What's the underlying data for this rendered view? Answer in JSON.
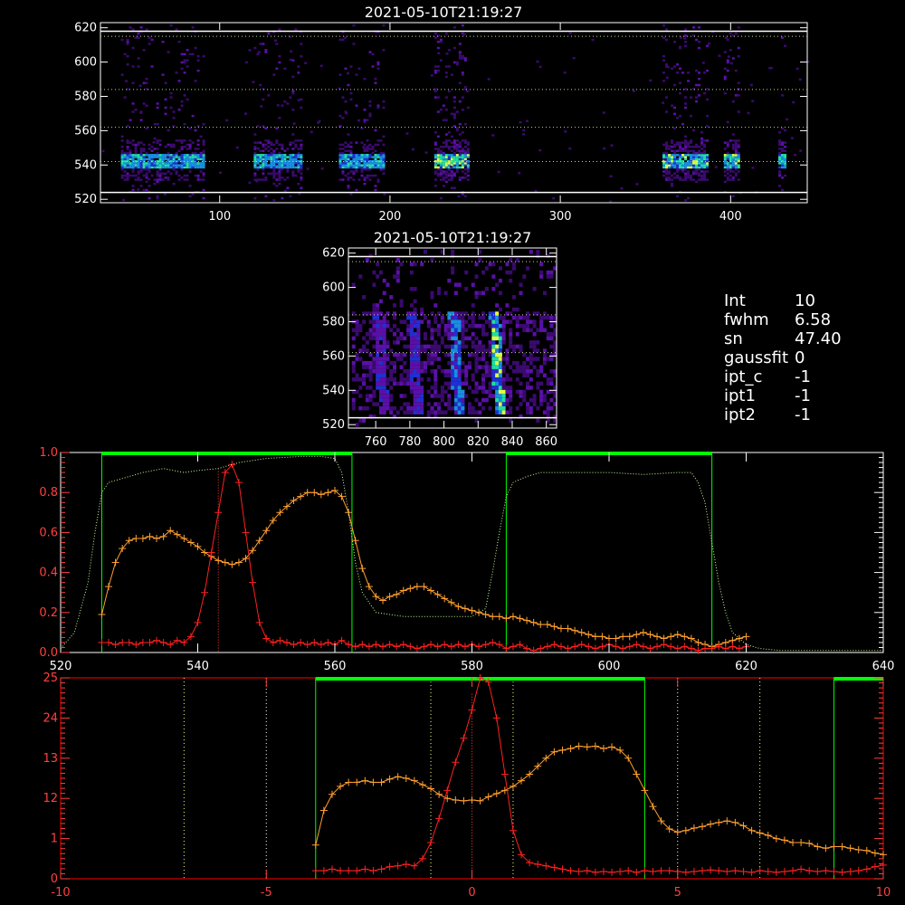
{
  "colors": {
    "background": "#000000",
    "axis": "#ffffff",
    "red_axis": "#ff0000",
    "spectrum_red": "#ff2020",
    "spectrum_orange": "#ffa030",
    "filter_green": "#00ff00",
    "filter_dotted": "#ccff99",
    "ref_lines": "#ffff80"
  },
  "panels": {
    "top": {
      "title": "2021-05-10T21:19:27",
      "x_ticks": [
        "100",
        "200",
        "300",
        "400"
      ],
      "y_ticks": [
        "520",
        "540",
        "560",
        "580",
        "600",
        "620"
      ]
    },
    "middle": {
      "title": "2021-05-10T21:19:27",
      "x_ticks": [
        "760",
        "780",
        "800",
        "820",
        "840",
        "860"
      ],
      "y_ticks": [
        "520",
        "540",
        "560",
        "580",
        "600",
        "620"
      ]
    }
  },
  "info": [
    {
      "key": "Int",
      "value": "10"
    },
    {
      "key": "fwhm",
      "value": "6.58"
    },
    {
      "key": "sn",
      "value": "47.40"
    },
    {
      "key": "gaussfit",
      "value": "0"
    },
    {
      "key": "ipt_c",
      "value": "-1"
    },
    {
      "key": "ipt1",
      "value": "-1"
    },
    {
      "key": "ipt2",
      "value": "-1"
    }
  ],
  "chart_data": [
    {
      "type": "heatmap",
      "title": "2021-05-10T21:19:27",
      "xlim": [
        30,
        445
      ],
      "ylim": [
        518,
        623
      ],
      "x_ticks": [
        100,
        200,
        300,
        400
      ],
      "y_ticks": [
        520,
        540,
        560,
        580,
        600,
        620
      ],
      "horizontal_lines": [
        542,
        562,
        584,
        615
      ],
      "solid_lines": [
        524,
        618
      ],
      "bands": [
        {
          "x0": 42,
          "x1": 90,
          "intensity": 0.6
        },
        {
          "x0": 120,
          "x1": 148,
          "intensity": 0.55
        },
        {
          "x0": 170,
          "x1": 196,
          "intensity": 0.55
        },
        {
          "x0": 226,
          "x1": 246,
          "intensity": 1.0
        },
        {
          "x0": 360,
          "x1": 386,
          "intensity": 0.9
        },
        {
          "x0": 396,
          "x1": 404,
          "intensity": 0.8
        },
        {
          "x0": 428,
          "x1": 432,
          "intensity": 0.6
        }
      ]
    },
    {
      "type": "heatmap",
      "title": "2021-05-10T21:19:27",
      "xlim": [
        744,
        866
      ],
      "ylim": [
        518,
        623
      ],
      "x_ticks": [
        760,
        780,
        800,
        820,
        840,
        860
      ],
      "y_ticks": [
        520,
        540,
        560,
        580,
        600,
        620
      ],
      "horizontal_lines": [
        562,
        584,
        615
      ],
      "solid_lines": [
        524,
        618
      ],
      "stripes": [
        {
          "x": 762,
          "intensity": 0.5
        },
        {
          "x": 782,
          "intensity": 0.55
        },
        {
          "x": 806,
          "intensity": 0.75
        },
        {
          "x": 830,
          "intensity": 1.0
        }
      ]
    },
    {
      "type": "line",
      "xlim": [
        520,
        640
      ],
      "ylim": [
        0,
        1.0
      ],
      "x_ticks": [
        520,
        540,
        560,
        580,
        600,
        620,
        640
      ],
      "y_ticks_left": [
        "0.0",
        "0.2",
        "0.4",
        "0.6",
        "0.8",
        "1.0"
      ],
      "y_tick_values": [
        0,
        0.2,
        0.4,
        0.6,
        0.8,
        1.0
      ],
      "vertical_lines_green": [
        526,
        562.5,
        585,
        615
      ],
      "green_bars": [
        [
          526,
          562.5
        ],
        [
          585,
          615
        ]
      ],
      "dotted_vline": 543,
      "series": [
        {
          "color": "orange",
          "x": [
            526,
            527,
            528,
            529,
            530,
            531,
            532,
            533,
            534,
            535,
            536,
            537,
            538,
            539,
            540,
            541,
            542,
            543,
            544,
            545,
            546,
            547,
            548,
            549,
            550,
            551,
            552,
            553,
            554,
            555,
            556,
            557,
            558,
            559,
            560,
            561,
            562,
            563,
            564,
            565,
            566,
            567,
            568,
            569,
            570,
            571,
            572,
            573,
            574,
            575,
            576,
            577,
            578,
            579,
            580,
            581,
            582,
            583,
            584,
            585,
            586,
            587,
            588,
            589,
            590,
            591,
            592,
            593,
            594,
            595,
            596,
            597,
            598,
            599,
            600,
            601,
            602,
            603,
            604,
            605,
            606,
            607,
            608,
            609,
            610,
            611,
            612,
            613,
            614,
            615,
            616,
            617,
            618,
            619,
            620
          ],
          "y": [
            0.19,
            0.33,
            0.45,
            0.52,
            0.56,
            0.57,
            0.57,
            0.58,
            0.57,
            0.58,
            0.61,
            0.59,
            0.57,
            0.55,
            0.53,
            0.5,
            0.48,
            0.46,
            0.45,
            0.44,
            0.45,
            0.47,
            0.51,
            0.56,
            0.61,
            0.66,
            0.7,
            0.73,
            0.76,
            0.78,
            0.8,
            0.8,
            0.79,
            0.8,
            0.81,
            0.78,
            0.7,
            0.56,
            0.42,
            0.33,
            0.28,
            0.26,
            0.28,
            0.29,
            0.31,
            0.32,
            0.33,
            0.33,
            0.31,
            0.29,
            0.27,
            0.25,
            0.23,
            0.22,
            0.21,
            0.2,
            0.19,
            0.18,
            0.18,
            0.17,
            0.18,
            0.17,
            0.16,
            0.15,
            0.14,
            0.14,
            0.13,
            0.12,
            0.12,
            0.11,
            0.1,
            0.09,
            0.08,
            0.08,
            0.07,
            0.07,
            0.08,
            0.08,
            0.09,
            0.1,
            0.09,
            0.08,
            0.07,
            0.08,
            0.09,
            0.08,
            0.07,
            0.05,
            0.04,
            0.03,
            0.04,
            0.05,
            0.06,
            0.07,
            0.08
          ]
        },
        {
          "color": "red",
          "x": [
            526,
            527,
            528,
            529,
            530,
            531,
            532,
            533,
            534,
            535,
            536,
            537,
            538,
            539,
            540,
            541,
            542,
            543,
            544,
            545,
            546,
            547,
            548,
            549,
            550,
            551,
            552,
            553,
            554,
            555,
            556,
            557,
            558,
            559,
            560,
            561,
            562,
            563,
            564,
            565,
            566,
            567,
            568,
            569,
            570,
            571,
            572,
            573,
            574,
            575,
            576,
            577,
            578,
            579,
            580,
            581,
            582,
            583,
            584,
            585,
            586,
            587,
            588,
            589,
            590,
            591,
            592,
            593,
            594,
            595,
            596,
            597,
            598,
            599,
            600,
            601,
            602,
            603,
            604,
            605,
            606,
            607,
            608,
            609,
            610,
            611,
            612,
            613,
            614,
            615,
            616,
            617,
            618,
            619,
            620
          ],
          "y": [
            0.05,
            0.05,
            0.04,
            0.05,
            0.05,
            0.04,
            0.05,
            0.05,
            0.06,
            0.05,
            0.04,
            0.06,
            0.05,
            0.08,
            0.15,
            0.3,
            0.5,
            0.7,
            0.9,
            0.94,
            0.85,
            0.6,
            0.35,
            0.15,
            0.07,
            0.05,
            0.06,
            0.05,
            0.04,
            0.05,
            0.04,
            0.05,
            0.04,
            0.05,
            0.04,
            0.06,
            0.04,
            0.03,
            0.04,
            0.03,
            0.04,
            0.03,
            0.04,
            0.03,
            0.04,
            0.03,
            0.02,
            0.03,
            0.04,
            0.03,
            0.04,
            0.03,
            0.04,
            0.03,
            0.04,
            0.03,
            0.04,
            0.05,
            0.04,
            0.02,
            0.03,
            0.04,
            0.02,
            0.01,
            0.02,
            0.03,
            0.04,
            0.03,
            0.02,
            0.03,
            0.04,
            0.03,
            0.02,
            0.03,
            0.04,
            0.03,
            0.02,
            0.03,
            0.04,
            0.03,
            0.02,
            0.03,
            0.04,
            0.03,
            0.02,
            0.03,
            0.02,
            0.01,
            0.02,
            0.02,
            0.03,
            0.02,
            0.03,
            0.02,
            0.03
          ]
        },
        {
          "color": "green-dotted",
          "x": [
            520,
            522,
            524,
            525,
            526,
            527,
            528,
            530,
            532,
            535,
            538,
            540,
            543,
            546,
            550,
            555,
            558,
            560,
            561,
            562,
            563,
            564,
            566,
            568,
            570,
            575,
            580,
            582,
            583,
            584,
            585,
            586,
            588,
            590,
            595,
            600,
            605,
            610,
            612,
            613,
            614,
            615,
            616,
            617,
            618,
            620,
            622,
            625,
            630,
            635,
            640
          ],
          "y": [
            0.02,
            0.1,
            0.35,
            0.6,
            0.8,
            0.85,
            0.86,
            0.88,
            0.9,
            0.92,
            0.9,
            0.91,
            0.92,
            0.95,
            0.97,
            0.98,
            0.98,
            0.97,
            0.9,
            0.7,
            0.45,
            0.3,
            0.2,
            0.19,
            0.18,
            0.18,
            0.18,
            0.22,
            0.4,
            0.6,
            0.78,
            0.85,
            0.88,
            0.9,
            0.9,
            0.9,
            0.89,
            0.9,
            0.9,
            0.85,
            0.75,
            0.55,
            0.35,
            0.2,
            0.1,
            0.04,
            0.02,
            0.01,
            0.01,
            0.01,
            0.01
          ]
        }
      ]
    },
    {
      "type": "line",
      "xlim": [
        -10,
        10
      ],
      "ylim": [
        0,
        2.5
      ],
      "x_ticks": [
        -10,
        -5,
        0,
        5,
        10
      ],
      "y_ticks_left": [
        "0",
        "1",
        "12",
        "13",
        "24",
        "25"
      ],
      "y_tick_values": [
        0,
        0.5,
        1.0,
        1.5,
        2.0,
        2.5
      ],
      "vertical_lines_green": [
        -3.8,
        4.2,
        8.8
      ],
      "green_bars": [
        [
          -3.8,
          4.2
        ],
        [
          8.8,
          10
        ]
      ],
      "dotted_vlines_white": [
        -5,
        5
      ],
      "dotted_vlines_yellow": [
        -7,
        -1,
        1,
        7
      ],
      "dotted_vline": 0,
      "series": [
        {
          "color": "orange",
          "x": [
            -3.8,
            -3.6,
            -3.4,
            -3.2,
            -3.0,
            -2.8,
            -2.6,
            -2.4,
            -2.2,
            -2.0,
            -1.8,
            -1.6,
            -1.4,
            -1.2,
            -1.0,
            -0.8,
            -0.6,
            -0.4,
            -0.2,
            0.0,
            0.2,
            0.4,
            0.6,
            0.8,
            1.0,
            1.2,
            1.4,
            1.6,
            1.8,
            2.0,
            2.2,
            2.4,
            2.6,
            2.8,
            3.0,
            3.2,
            3.4,
            3.6,
            3.8,
            4.0,
            4.2,
            4.4,
            4.6,
            4.8,
            5.0,
            5.2,
            5.4,
            5.6,
            5.8,
            6.0,
            6.2,
            6.4,
            6.6,
            6.8,
            7.0,
            7.2,
            7.4,
            7.6,
            7.8,
            8.0,
            8.2,
            8.4,
            8.6,
            8.8,
            9.0,
            9.2,
            9.4,
            9.6,
            9.8,
            10.0
          ],
          "y": [
            0.42,
            0.85,
            1.05,
            1.15,
            1.2,
            1.2,
            1.22,
            1.2,
            1.2,
            1.24,
            1.27,
            1.25,
            1.22,
            1.17,
            1.12,
            1.05,
            1.0,
            0.98,
            0.97,
            0.98,
            0.97,
            1.02,
            1.06,
            1.1,
            1.15,
            1.22,
            1.3,
            1.4,
            1.5,
            1.58,
            1.6,
            1.62,
            1.65,
            1.64,
            1.65,
            1.62,
            1.64,
            1.6,
            1.5,
            1.3,
            1.1,
            0.9,
            0.72,
            0.62,
            0.58,
            0.6,
            0.63,
            0.65,
            0.68,
            0.7,
            0.72,
            0.7,
            0.66,
            0.6,
            0.57,
            0.54,
            0.5,
            0.48,
            0.45,
            0.45,
            0.44,
            0.4,
            0.38,
            0.4,
            0.4,
            0.38,
            0.36,
            0.35,
            0.32,
            0.3
          ]
        },
        {
          "color": "red",
          "x": [
            -3.8,
            -3.6,
            -3.4,
            -3.2,
            -3.0,
            -2.8,
            -2.6,
            -2.4,
            -2.2,
            -2.0,
            -1.8,
            -1.6,
            -1.4,
            -1.2,
            -1.0,
            -0.8,
            -0.6,
            -0.4,
            -0.2,
            0.0,
            0.2,
            0.4,
            0.6,
            0.8,
            1.0,
            1.2,
            1.4,
            1.6,
            1.8,
            2.0,
            2.2,
            2.4,
            2.6,
            2.8,
            3.0,
            3.2,
            3.4,
            3.6,
            3.8,
            4.0,
            4.2,
            4.4,
            4.6,
            4.8,
            5.0,
            5.2,
            5.4,
            5.6,
            5.8,
            6.0,
            6.2,
            6.4,
            6.6,
            6.8,
            7.0,
            7.2,
            7.4,
            7.6,
            7.8,
            8.0,
            8.2,
            8.4,
            8.6,
            8.8,
            9.0,
            9.2,
            9.4,
            9.6,
            9.8,
            10.0
          ],
          "y": [
            0.1,
            0.1,
            0.12,
            0.1,
            0.1,
            0.1,
            0.12,
            0.1,
            0.12,
            0.15,
            0.16,
            0.18,
            0.16,
            0.25,
            0.45,
            0.75,
            1.1,
            1.45,
            1.75,
            2.1,
            2.5,
            2.45,
            2.0,
            1.3,
            0.6,
            0.3,
            0.2,
            0.18,
            0.16,
            0.14,
            0.12,
            0.1,
            0.09,
            0.1,
            0.08,
            0.09,
            0.08,
            0.09,
            0.1,
            0.08,
            0.1,
            0.09,
            0.1,
            0.1,
            0.09,
            0.08,
            0.09,
            0.1,
            0.11,
            0.1,
            0.09,
            0.1,
            0.09,
            0.08,
            0.1,
            0.09,
            0.08,
            0.09,
            0.1,
            0.12,
            0.1,
            0.09,
            0.1,
            0.09,
            0.08,
            0.09,
            0.1,
            0.12,
            0.15,
            0.17
          ]
        }
      ]
    }
  ]
}
